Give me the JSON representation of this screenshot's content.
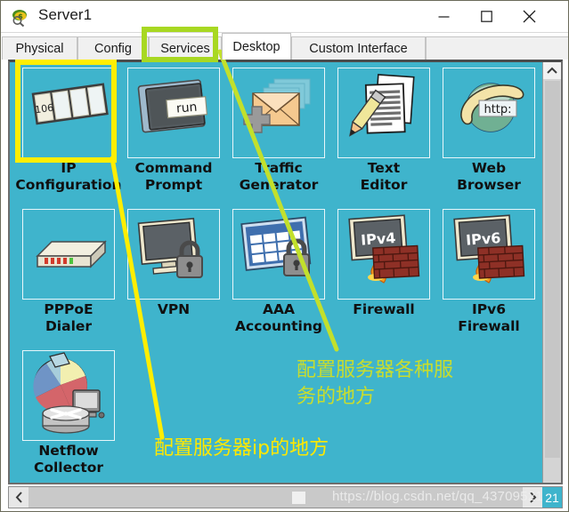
{
  "window": {
    "title": "Server1",
    "app_icon": "packet-tracer-icon",
    "controls": {
      "minimize": "minimize-icon",
      "maximize": "maximize-icon",
      "close": "close-icon"
    }
  },
  "tabs": [
    {
      "label": "Physical",
      "active": false
    },
    {
      "label": "Config",
      "active": false
    },
    {
      "label": "Services",
      "active": false
    },
    {
      "label": "Desktop",
      "active": true
    },
    {
      "label": "Custom Interface",
      "active": false
    }
  ],
  "desktop": {
    "background_color": "#3fb4cc",
    "items": [
      {
        "label": "IP\nConfiguration",
        "icon": "ip-configuration-icon",
        "badge": "106",
        "highlighted": true
      },
      {
        "label": "Command\nPrompt",
        "icon": "command-prompt-icon",
        "badge": "run",
        "highlighted": false
      },
      {
        "label": "Traffic\nGenerator",
        "icon": "traffic-generator-icon",
        "badge": "",
        "highlighted": false
      },
      {
        "label": "Text\nEditor",
        "icon": "text-editor-icon",
        "badge": "",
        "highlighted": false
      },
      {
        "label": "Web\nBrowser",
        "icon": "web-browser-icon",
        "badge": "http:",
        "highlighted": false
      },
      {
        "label": "PPPoE\nDialer",
        "icon": "pppoe-dialer-icon",
        "badge": "",
        "highlighted": false
      },
      {
        "label": "VPN",
        "icon": "vpn-icon",
        "badge": "",
        "highlighted": false
      },
      {
        "label": "AAA\nAccounting",
        "icon": "aaa-accounting-icon",
        "badge": "",
        "highlighted": false
      },
      {
        "label": "Firewall",
        "icon": "firewall-icon",
        "badge": "IPv4",
        "highlighted": false
      },
      {
        "label": "IPv6\nFirewall",
        "icon": "ipv6-firewall-icon",
        "badge": "IPv6",
        "highlighted": false
      },
      {
        "label": "Netflow\nCollector",
        "icon": "netflow-collector-icon",
        "badge": "",
        "highlighted": false
      }
    ]
  },
  "annotations": {
    "green": {
      "text": "配置服务器各种服\n务的地方",
      "color": "#c8dd2e",
      "points_to": "Services"
    },
    "yellow": {
      "text": "配置服务器ip的地方",
      "color": "#ffe800",
      "points_to": "IP Configuration"
    }
  },
  "scrollbars": {
    "vertical_up": "chevron-up-icon",
    "horizontal_left": "chevron-left-icon",
    "horizontal_right": "chevron-right-icon",
    "corner_label": "21"
  },
  "watermark": "https://blog.csdn.net/qq_43709521"
}
